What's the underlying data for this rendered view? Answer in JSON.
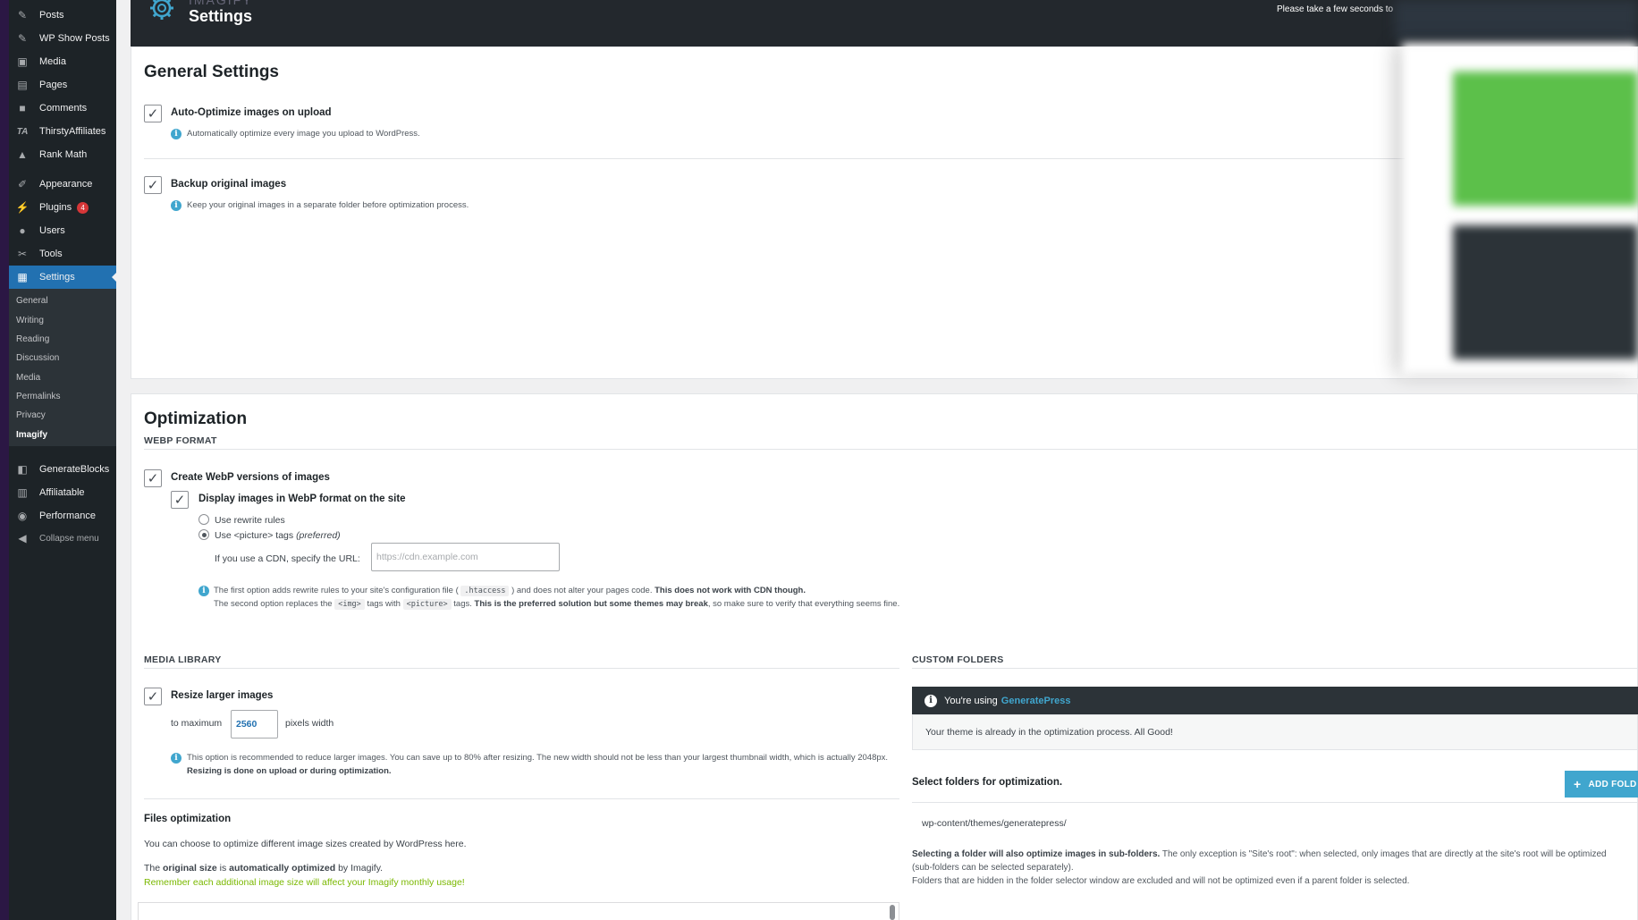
{
  "sidebar": {
    "items": [
      {
        "label": "Posts",
        "icon": "pin-icon"
      },
      {
        "label": "WP Show Posts",
        "icon": "pin-icon"
      },
      {
        "label": "Media",
        "icon": "media-icon"
      },
      {
        "label": "Pages",
        "icon": "page-icon"
      },
      {
        "label": "Comments",
        "icon": "comment-icon"
      },
      {
        "label": "ThirstyAffiliates",
        "icon": "ta-icon"
      },
      {
        "label": "Rank Math",
        "icon": "chart-icon"
      },
      {
        "label": "Appearance",
        "icon": "brush-icon"
      },
      {
        "label": "Plugins",
        "icon": "plug-icon",
        "badge": "4"
      },
      {
        "label": "Users",
        "icon": "user-icon"
      },
      {
        "label": "Tools",
        "icon": "wrench-icon"
      },
      {
        "label": "Settings",
        "icon": "settings-icon"
      },
      {
        "label": "GenerateBlocks",
        "icon": "blocks-icon"
      },
      {
        "label": "Affiliatable",
        "icon": "table-icon"
      },
      {
        "label": "Performance",
        "icon": "performance-icon"
      },
      {
        "label": "Collapse menu",
        "icon": "collapse-icon"
      }
    ],
    "submenu": [
      "General",
      "Writing",
      "Reading",
      "Discussion",
      "Media",
      "Permalinks",
      "Privacy",
      "Imagify"
    ],
    "active": "Settings",
    "current_sub": "Imagify"
  },
  "header": {
    "ghost_brand": "IMAGIFY",
    "title": "Settings",
    "notice": "Please take a few seconds to"
  },
  "general": {
    "title": "General Settings",
    "auto_optimize": {
      "label": "Auto-Optimize images on upload",
      "help": "Automatically optimize every image you upload to WordPress.",
      "checked": true
    },
    "backup": {
      "label": "Backup original images",
      "help": "Keep your original images in a separate folder before optimization process.",
      "checked": true
    }
  },
  "optimization": {
    "title": "Optimization",
    "webp_heading": "WEBP FORMAT",
    "create_webp": {
      "label": "Create WebP versions of images",
      "checked": true
    },
    "display_webp": {
      "label": "Display images in WebP format on the site",
      "checked": true
    },
    "radio_rewrite": "Use rewrite rules",
    "radio_picture": "Use <picture> tags",
    "radio_picture_note": "(preferred)",
    "selected_radio": "picture",
    "cdn_label": "If you use a CDN, specify the URL:",
    "cdn_placeholder": "https://cdn.example.com",
    "help1_a": "The first option adds rewrite rules to your site's configuration file (",
    "help1_code": ".htaccess",
    "help1_b": ") and does not alter your pages code.",
    "help1_bold": "This does not work with CDN though.",
    "help2_a": "The second option replaces the",
    "help2_code1": "<img>",
    "help2_b": "tags with",
    "help2_code2": "<picture>",
    "help2_c": "tags.",
    "help2_bold": "This is the preferred solution but some themes may break",
    "help2_d": ", so make sure to verify that everything seems fine."
  },
  "media_library": {
    "heading": "MEDIA LIBRARY",
    "resize": {
      "label": "Resize larger images",
      "checked": true
    },
    "to_maximum": "to maximum",
    "max_width": "2560",
    "pixels_width": "pixels width",
    "help_a": "This option is recommended to reduce larger images. You can save up to 80% after resizing. The new width should not be less than your largest thumbnail width, which is actually",
    "help_b": "2048px.",
    "help_bold": "Resizing is done on upload or during optimization.",
    "files_title": "Files optimization",
    "files_desc": "You can choose to optimize different image sizes created by WordPress here.",
    "original_a": "The",
    "original_b": "original size",
    "original_c": "is",
    "original_d": "automatically optimized",
    "original_e": "by Imagify.",
    "remember": "Remember each additional image size will affect your Imagify monthly usage!"
  },
  "custom_folders": {
    "heading": "CUSTOM FOLDERS",
    "using": "You're using",
    "theme": "GeneratePress",
    "status": "Your theme is already in the optimization process. All Good!",
    "select_label": "Select folders for optimization.",
    "add_button": "ADD FOLD",
    "folder_path": "wp-content/themes/generatepress/",
    "note_bold": "Selecting a folder will also optimize images in sub-folders.",
    "note_a": "The only exception is \"Site's root\": when selected, only images that are directly at the site's root will be optimized (sub-folders can be selected separately).",
    "note_b": "Folders that are hidden in the folder selector window are excluded and will not be optimized even if a parent folder is selected."
  },
  "colors": {
    "wp_blue": "#2271b1",
    "imagify_blue": "#40a6ce",
    "imagify_green": "#7ab800",
    "admin_dark": "#1d2327"
  }
}
